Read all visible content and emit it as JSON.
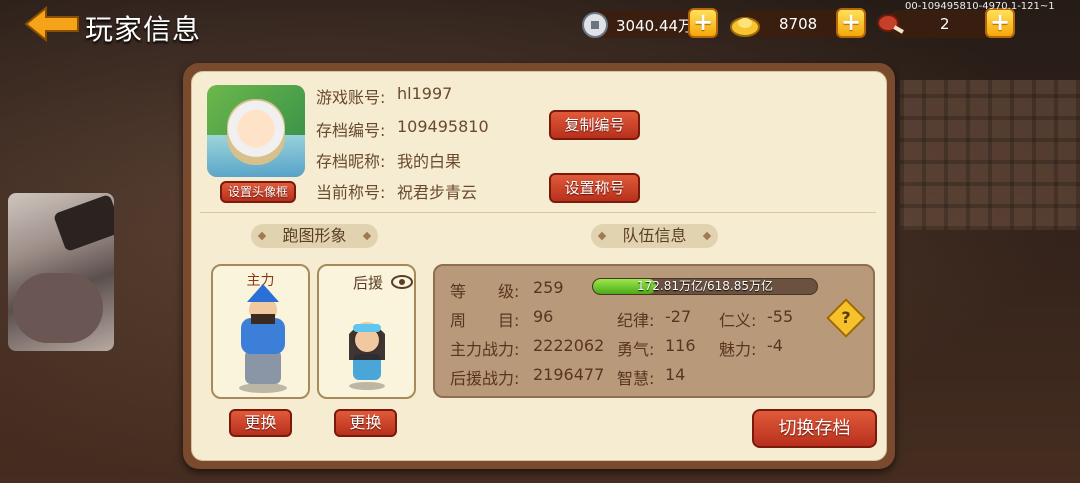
{
  "header": {
    "title": "玩家信息",
    "build_id": "00-109495810-4970.1-121~1"
  },
  "resources": [
    {
      "icon": "silver-coin-icon",
      "value": "3040.44万"
    },
    {
      "icon": "gold-ingot-icon",
      "value": "8708"
    },
    {
      "icon": "meat-icon",
      "value": "2"
    }
  ],
  "profile": {
    "set_avatar_frame": "设置头像框",
    "account_label": "游戏账号:",
    "account_value": "hl1997",
    "save_id_label": "存档编号:",
    "save_id_value": "109495810",
    "nickname_label": "存档昵称:",
    "nickname_value": "我的白果",
    "title_label": "当前称号:",
    "title_value": "祝君步青云",
    "copy_id_button": "复制编号",
    "set_title_button": "设置称号"
  },
  "appearance": {
    "heading": "跑图形象",
    "main_label": "主力",
    "support_label": "后援",
    "replace_button": "更换"
  },
  "team": {
    "heading": "队伍信息",
    "level_label": "等　　级:",
    "level_value": "259",
    "exp_text": "172.81万亿/618.85万亿",
    "exp_fraction": 0.2793,
    "week_label": "周　　目:",
    "week_value": "96",
    "discipline_label": "纪律:",
    "discipline_value": "-27",
    "benevolence_label": "仁义:",
    "benevolence_value": "-55",
    "main_power_label": "主力战力:",
    "main_power_value": "2222062",
    "courage_label": "勇气:",
    "courage_value": "116",
    "charm_label": "魅力:",
    "charm_value": "-4",
    "support_power_label": "后援战力:",
    "support_power_value": "2196477",
    "wisdom_label": "智慧:",
    "wisdom_value": "14",
    "help_symbol": "?"
  },
  "switch_save_button": "切换存档"
}
